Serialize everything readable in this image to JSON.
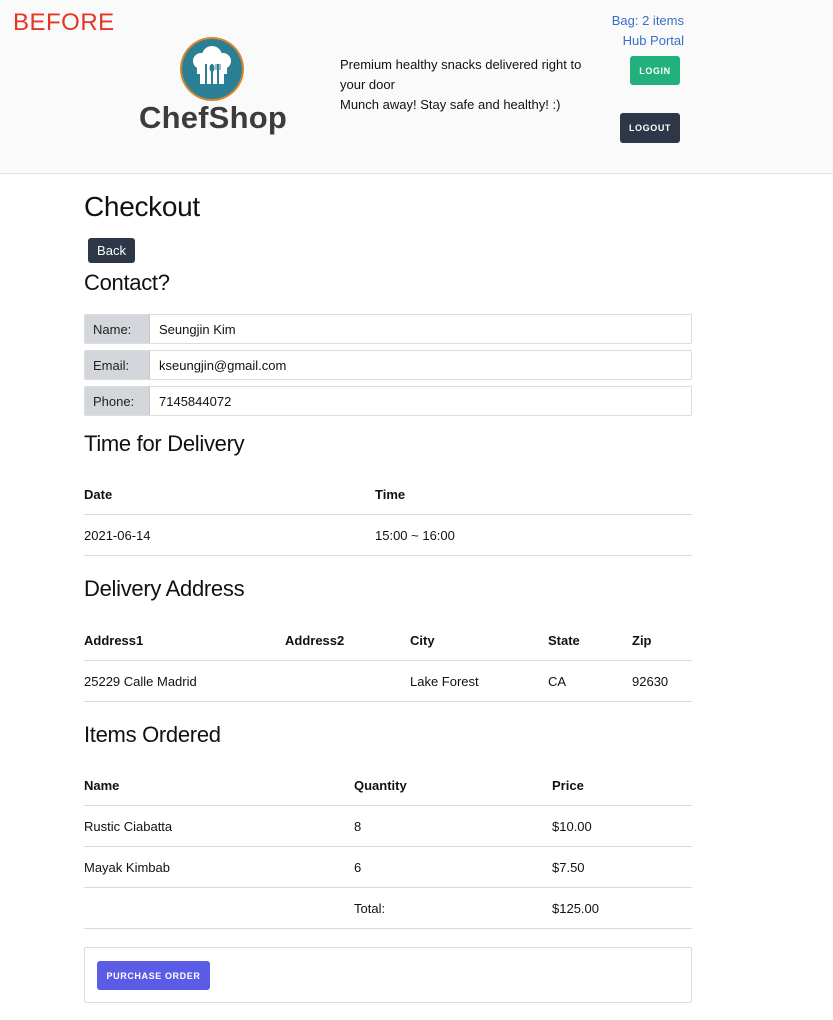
{
  "annotation": {
    "label": "BEFORE"
  },
  "header": {
    "brand": "ChefShop",
    "tagline_line1": "Premium healthy snacks delivered right to your door",
    "tagline_line2": "Munch away! Stay safe and healthy! :)",
    "bag_link": "Bag: 2 items",
    "hub_link": "Hub Portal",
    "login_label": "LOGIN",
    "logout_label": "LOGOUT",
    "logo_icon": "chef-hat-icon"
  },
  "colors": {
    "annotation": "#e53524",
    "login": "#22b07d",
    "logout": "#2d3748",
    "purchase": "#5a5ce6",
    "link": "#3a6fc9"
  },
  "page": {
    "title": "Checkout",
    "back_label": "Back"
  },
  "contact": {
    "heading": "Contact?",
    "fields": [
      {
        "label": "Name:",
        "value": "Seungjin Kim"
      },
      {
        "label": "Email:",
        "value": "kseungjin@gmail.com"
      },
      {
        "label": "Phone:",
        "value": "7145844072"
      }
    ]
  },
  "delivery_time": {
    "heading": "Time for Delivery",
    "columns": [
      "Date",
      "Time"
    ],
    "row": [
      "2021-06-14",
      "15:00 ~ 16:00"
    ]
  },
  "delivery_address": {
    "heading": "Delivery Address",
    "columns": [
      "Address1",
      "Address2",
      "City",
      "State",
      "Zip"
    ],
    "row": [
      "25229 Calle Madrid",
      "",
      "Lake Forest",
      "CA",
      "92630"
    ]
  },
  "items": {
    "heading": "Items Ordered",
    "columns": [
      "Name",
      "Quantity",
      "Price"
    ],
    "rows": [
      [
        "Rustic Ciabatta",
        "8",
        "$10.00"
      ],
      [
        "Mayak Kimbab",
        "6",
        "$7.50"
      ]
    ],
    "total_label": "Total:",
    "total_value": "$125.00"
  },
  "purchase": {
    "label": "PURCHASE ORDER"
  }
}
